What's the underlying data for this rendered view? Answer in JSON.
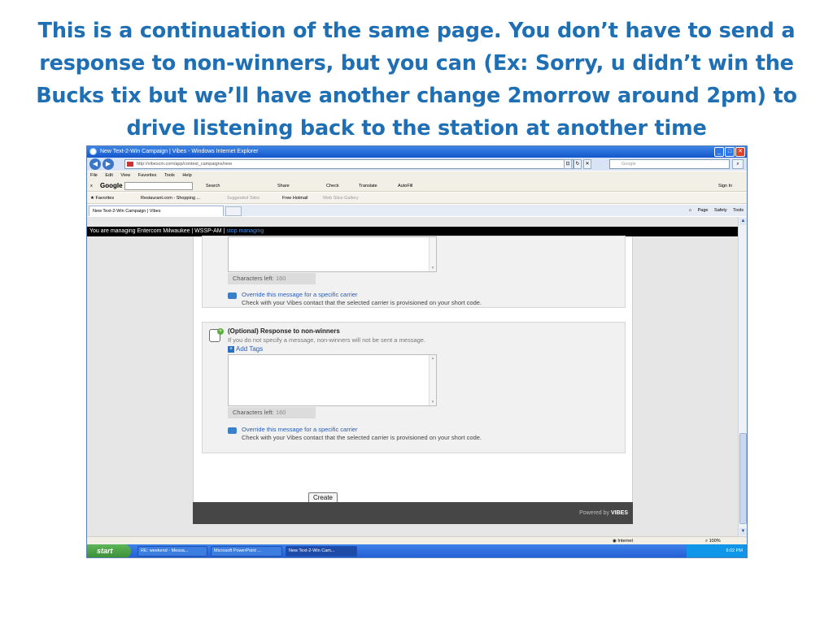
{
  "slide": {
    "heading": "This is a continuation of the same page. You don’t have to send a response to non-winners, but you can (Ex: Sorry, u didn’t win the Bucks tix but we’ll have another change 2morrow around 2pm) to drive listening back to the station at another time"
  },
  "browser": {
    "window_title": "New Text-2-Win Campaign | Vibes - Windows Internet Explorer",
    "address": "http://vibescm.com/app/contest_campaigns/new",
    "search_placeholder": "Google",
    "menu": [
      "File",
      "Edit",
      "View",
      "Favorites",
      "Tools",
      "Help"
    ],
    "google_bar": {
      "close": "x",
      "logo": "Google",
      "search": "Search",
      "share": "Share",
      "check": "Check",
      "translate": "Translate",
      "autofill": "AutoFill",
      "sign_in": "Sign In"
    },
    "favorites_bar": {
      "favorites": "Favorites",
      "item1": "Restaurant.com - Shopping ...",
      "item2": "Suggested Sites",
      "item3": "Free Hotmail",
      "item4": "Web Slice Gallery"
    },
    "tab_label": "New Text-2-Win Campaign | Vibes",
    "command_bar": {
      "page": "Page",
      "safety": "Safety",
      "tools": "Tools"
    },
    "status": {
      "zone": "Internet",
      "zoom": "100%"
    }
  },
  "page": {
    "managing_text": "You are managing Entercom Milwaukee | WSSP-AM |",
    "stop_managing": "stop managing",
    "section1": {
      "chars_left_label": "Characters left:",
      "chars_left_value": "160",
      "override_link": "Override this message for a specific carrier",
      "override_note": "Check with your Vibes contact that the selected carrier is provisioned on your short code."
    },
    "section2": {
      "title": "(Optional) Response to non-winners",
      "description": "If you do not specify a message, non-winners will not be sent a message.",
      "add_tags": "Add Tags",
      "chars_left_label": "Characters left:",
      "chars_left_value": "160",
      "override_link": "Override this message for a specific carrier",
      "override_note": "Check with your Vibes contact that the selected carrier is provisioned on your short code."
    },
    "create_button": "Create",
    "powered_by": "Powered by",
    "brand": "VIBES"
  },
  "taskbar": {
    "start": "start",
    "tasks": [
      "RE: weekend - Messa...",
      "Microsoft PowerPoint ...",
      "New Text-2-Win Cam..."
    ],
    "clock": "6:02 PM"
  }
}
